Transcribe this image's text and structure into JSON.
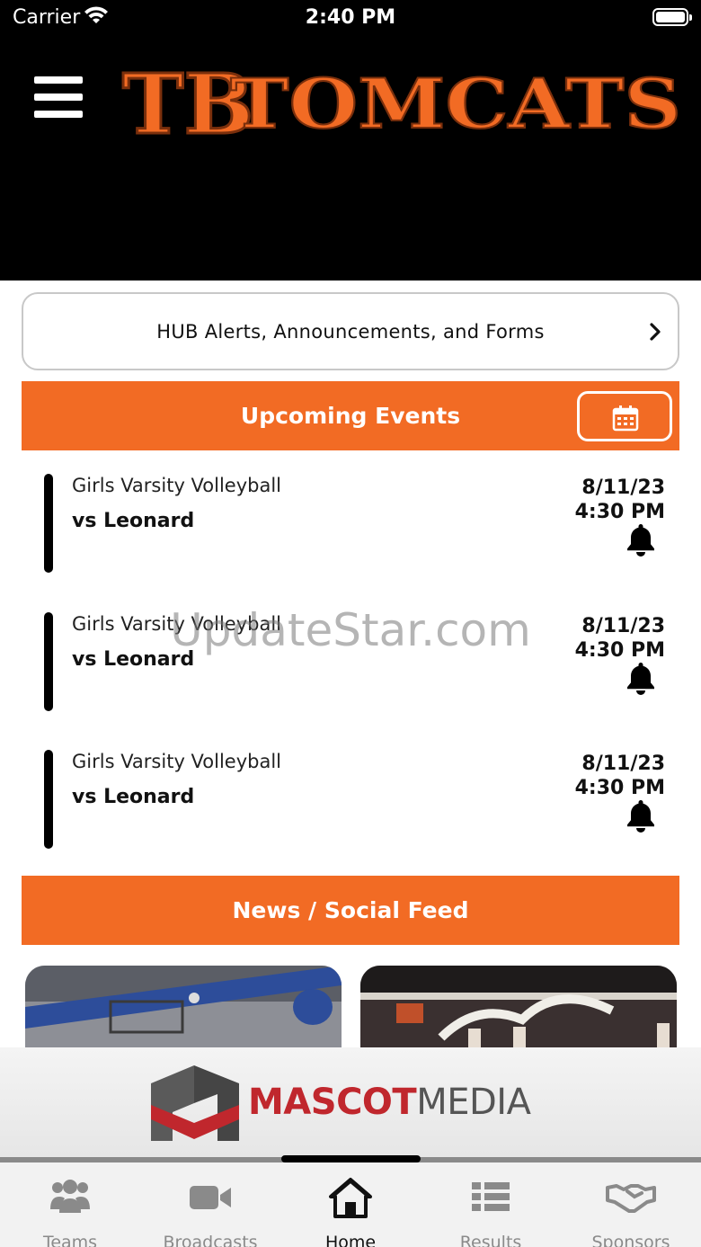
{
  "status_bar": {
    "carrier": "Carrier",
    "time": "2:40 PM"
  },
  "header": {
    "logo_monogram": "TB",
    "logo_text": "TOMCATS"
  },
  "hub_button": {
    "label": "HUB Alerts, Announcements, and Forms"
  },
  "upcoming": {
    "title": "Upcoming Events",
    "events": [
      {
        "sport": "Girls Varsity Volleyball",
        "opponent": "vs Leonard",
        "date": "8/11/23",
        "time": "4:30 PM"
      },
      {
        "sport": "Girls Varsity Volleyball",
        "opponent": "vs Leonard",
        "date": "8/11/23",
        "time": "4:30 PM"
      },
      {
        "sport": "Girls Varsity Volleyball",
        "opponent": "vs Leonard",
        "date": "8/11/23",
        "time": "4:30 PM"
      }
    ]
  },
  "news": {
    "title": "News / Social Feed"
  },
  "watermark": "UpdateStar.com",
  "sponsor": {
    "brand_a": "MASCOT",
    "brand_b": "MEDIA"
  },
  "tabs": [
    {
      "label": "Teams",
      "icon": "people-icon"
    },
    {
      "label": "Broadcasts",
      "icon": "video-camera-icon"
    },
    {
      "label": "Home",
      "icon": "home-icon"
    },
    {
      "label": "Results",
      "icon": "list-icon"
    },
    {
      "label": "Sponsors",
      "icon": "handshake-icon"
    }
  ],
  "colors": {
    "accent": "#f26b24",
    "header_bg": "#000000",
    "sponsor_red": "#c0272d"
  }
}
